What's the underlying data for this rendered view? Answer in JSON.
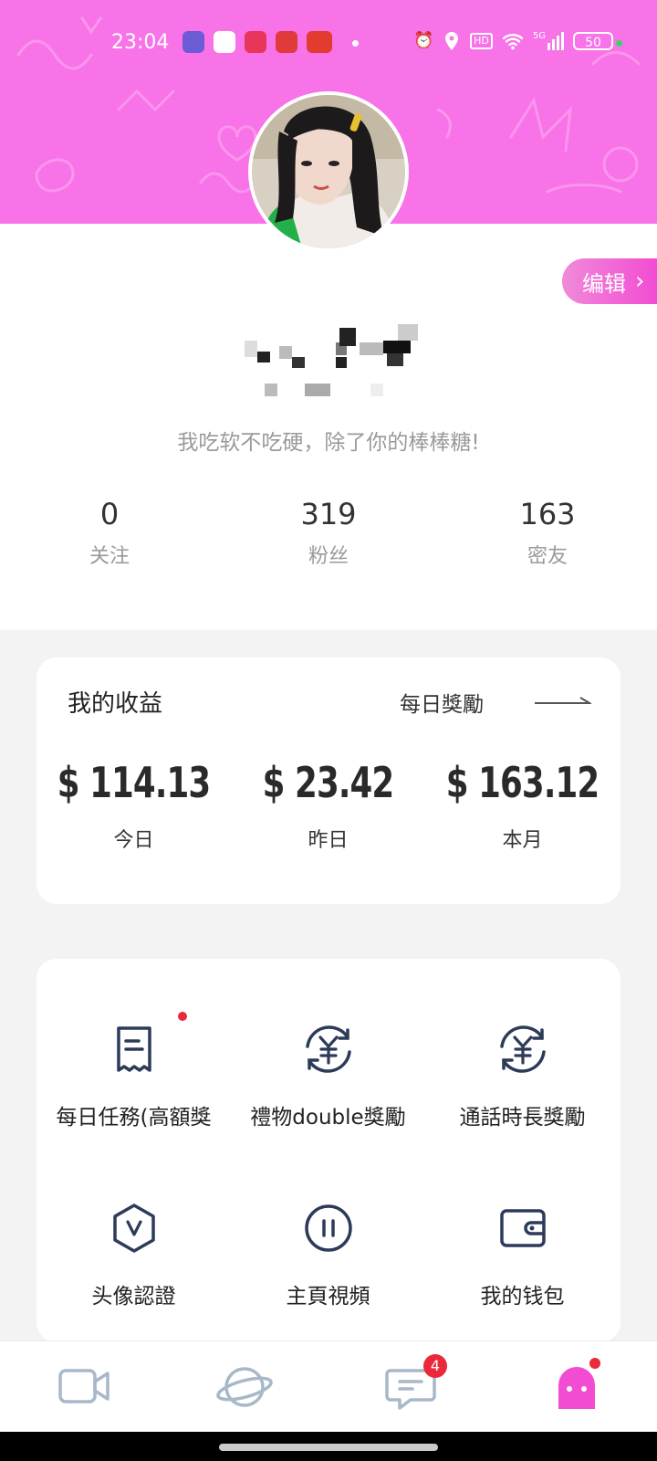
{
  "status_bar": {
    "time": "23:04",
    "hd": "HD",
    "network": "5G",
    "battery": "50"
  },
  "profile": {
    "edit_label": "编辑",
    "bio": "我吃软不吃硬，除了你的棒棒糖!",
    "stats": [
      {
        "value": "0",
        "label": "关注"
      },
      {
        "value": "319",
        "label": "粉丝"
      },
      {
        "value": "163",
        "label": "密友"
      }
    ]
  },
  "earnings": {
    "title": "我的收益",
    "daily_reward": "每日獎勵",
    "items": [
      {
        "amount": "$ 114.13",
        "label": "今日"
      },
      {
        "amount": "$ 23.42",
        "label": "昨日"
      },
      {
        "amount": "$ 163.12",
        "label": "本月"
      }
    ]
  },
  "features": [
    {
      "label": "每日任務(高額獎",
      "icon": "receipt-icon",
      "has_dot": true
    },
    {
      "label": "禮物double獎勵",
      "icon": "yen-exchange-icon"
    },
    {
      "label": "通話時長獎勵",
      "icon": "yen-exchange-icon"
    },
    {
      "label": "头像認證",
      "icon": "shield-v-icon"
    },
    {
      "label": "主頁視頻",
      "icon": "pause-circle-icon"
    },
    {
      "label": "我的钱包",
      "icon": "wallet-icon"
    }
  ],
  "bottom_nav": {
    "items": [
      {
        "name": "video",
        "icon": "video-camera-icon"
      },
      {
        "name": "discover",
        "icon": "planet-icon"
      },
      {
        "name": "messages",
        "icon": "chat-icon",
        "badge": "4"
      },
      {
        "name": "me",
        "icon": "ghost-icon"
      }
    ]
  },
  "colors": {
    "accent": "#f872e8",
    "accent_pink": "#f24cd3",
    "icon_navy": "#2d3b5a",
    "badge_red": "#ea2a3a"
  }
}
